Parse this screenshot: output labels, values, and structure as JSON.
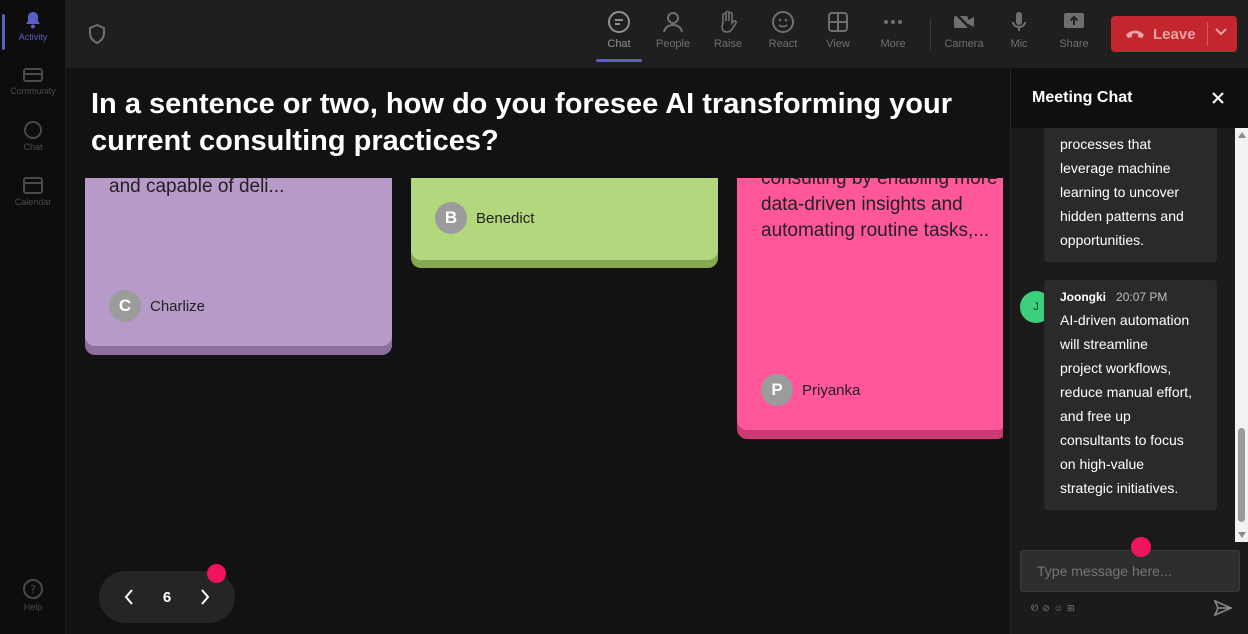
{
  "rail": {
    "items": [
      {
        "label": "Activity",
        "icon": "bell-icon",
        "active": true
      },
      {
        "label": "Community",
        "icon": "community-icon"
      },
      {
        "label": "Chat",
        "icon": "chat-icon"
      },
      {
        "label": "Calendar",
        "icon": "calendar-icon"
      },
      {
        "label": "Help",
        "icon": "help-icon"
      }
    ]
  },
  "toolbar": {
    "chat": "Chat",
    "people": "People",
    "raise": "Raise",
    "react": "React",
    "view": "View",
    "more": "More",
    "camera": "Camera",
    "mic": "Mic",
    "share": "Share",
    "leave": "Leave"
  },
  "stage": {
    "question": "In a sentence or two, how do you foresee AI transforming your current consulting practices?",
    "cards": [
      {
        "text": "and capable of deli...",
        "author": "Charlize",
        "initial": "C",
        "color": "#b79ac8"
      },
      {
        "text": "",
        "author": "Benedict",
        "initial": "B",
        "color": "#b3d77c"
      },
      {
        "text_line1": "consulting by enabling more",
        "text_line2": "data-driven insights and",
        "text_line3": "automating routine tasks,...",
        "author": "Priyanka",
        "initial": "P",
        "color": "#ff579a"
      }
    ],
    "pager": {
      "page": "6"
    }
  },
  "chat": {
    "title": "Meeting Chat",
    "messages": [
      {
        "lines": [
          "processes that",
          "leverage machine",
          "learning to uncover",
          "hidden patterns and",
          "opportunities."
        ]
      },
      {
        "sender": "Joongki",
        "time": "20:07 PM",
        "initial": "J",
        "lines": [
          "AI-driven automation",
          "will streamline",
          "project workflows,",
          "reduce manual effort,",
          "and free up",
          "consultants to focus",
          "on high-value",
          "strategic initiatives."
        ]
      }
    ],
    "input_placeholder": "Type message here..."
  }
}
